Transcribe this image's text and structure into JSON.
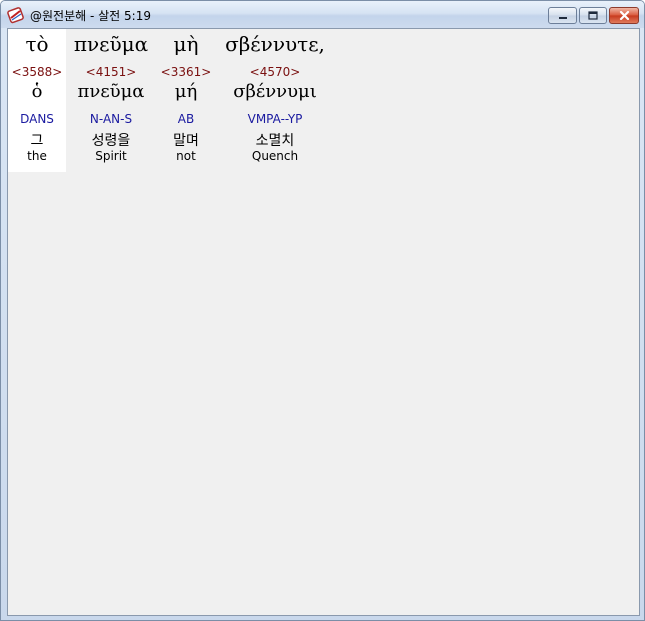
{
  "window": {
    "title": "@원전분해 - 살전 5:19",
    "controls": {
      "minimize_icon": "minimize-icon",
      "maximize_icon": "maximize-icon",
      "close_icon": "close-icon"
    }
  },
  "words": [
    {
      "surface": "τὸ",
      "strongs": "<3588>",
      "lemma": "ὁ",
      "parsing": "DANS",
      "korean": "그",
      "english": "the"
    },
    {
      "surface": "πνεῦμα",
      "strongs": "<4151>",
      "lemma": "πνεῦμα",
      "parsing": "N-AN-S",
      "korean": "성령을",
      "english": "Spirit"
    },
    {
      "surface": "μὴ",
      "strongs": "<3361>",
      "lemma": "μή",
      "parsing": "AB",
      "korean": "말며",
      "english": "not"
    },
    {
      "surface": "σβέννυτε,",
      "strongs": "<4570>",
      "lemma": "σβέννυμι",
      "parsing": "VMPA--YP",
      "korean": "소멸치",
      "english": "Quench"
    }
  ],
  "colors": {
    "strongs": "#7a1010",
    "parsing": "#1a1aa0",
    "selected_bg": "#ffffff",
    "client_bg": "#f0f0f0"
  }
}
